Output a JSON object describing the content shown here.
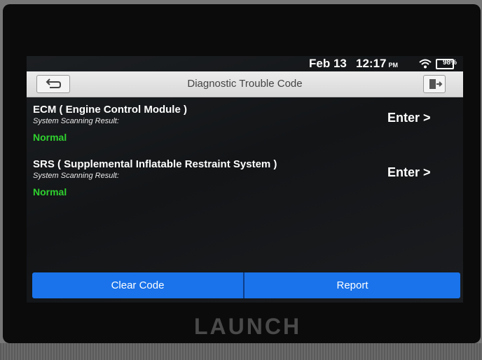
{
  "status": {
    "date": "Feb 13",
    "time": "12:17",
    "ampm": "PM",
    "battery": "98%"
  },
  "header": {
    "title": "Diagnostic Trouble Code"
  },
  "modules": [
    {
      "name": "ECM ( Engine Control Module )",
      "scan_label": "System Scanning Result:",
      "scan_value": "Normal",
      "enter_label": "Enter >"
    },
    {
      "name": "SRS ( Supplemental Inflatable Restraint System )",
      "scan_label": "System Scanning Result:",
      "scan_value": "Normal",
      "enter_label": "Enter >"
    }
  ],
  "footer": {
    "clear_label": "Clear Code",
    "report_label": "Report"
  },
  "device": {
    "brand": "LAUNCH"
  },
  "colors": {
    "accent": "#1a73ea",
    "normal": "#2fd12f",
    "title_bar": "#e2e2e2"
  }
}
